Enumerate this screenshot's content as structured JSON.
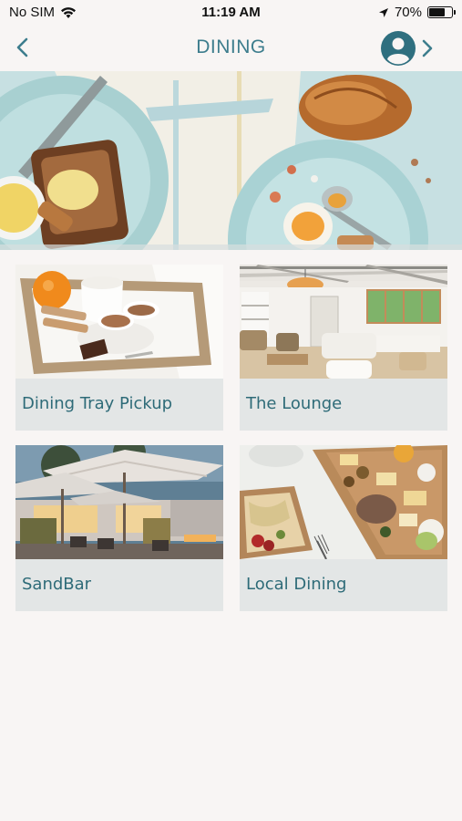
{
  "status_bar": {
    "carrier": "No SIM",
    "time": "11:19 AM",
    "battery_percent": "70%",
    "battery_level": 0.7
  },
  "nav": {
    "title": "DINING",
    "back_icon": "chevron-left-icon",
    "account_icon": "user-circle-icon"
  },
  "colors": {
    "accent": "#3d7d8d",
    "card_bg": "#e3e6e6",
    "page_bg": "#f8f5f4"
  },
  "cards": [
    {
      "label": "Dining Tray Pickup",
      "image": "breakfast-tray-photo"
    },
    {
      "label": "The Lounge",
      "image": "lounge-interior-photo"
    },
    {
      "label": "SandBar",
      "image": "outdoor-patio-umbrellas-photo"
    },
    {
      "label": "Local Dining",
      "image": "cheese-board-photo"
    }
  ]
}
